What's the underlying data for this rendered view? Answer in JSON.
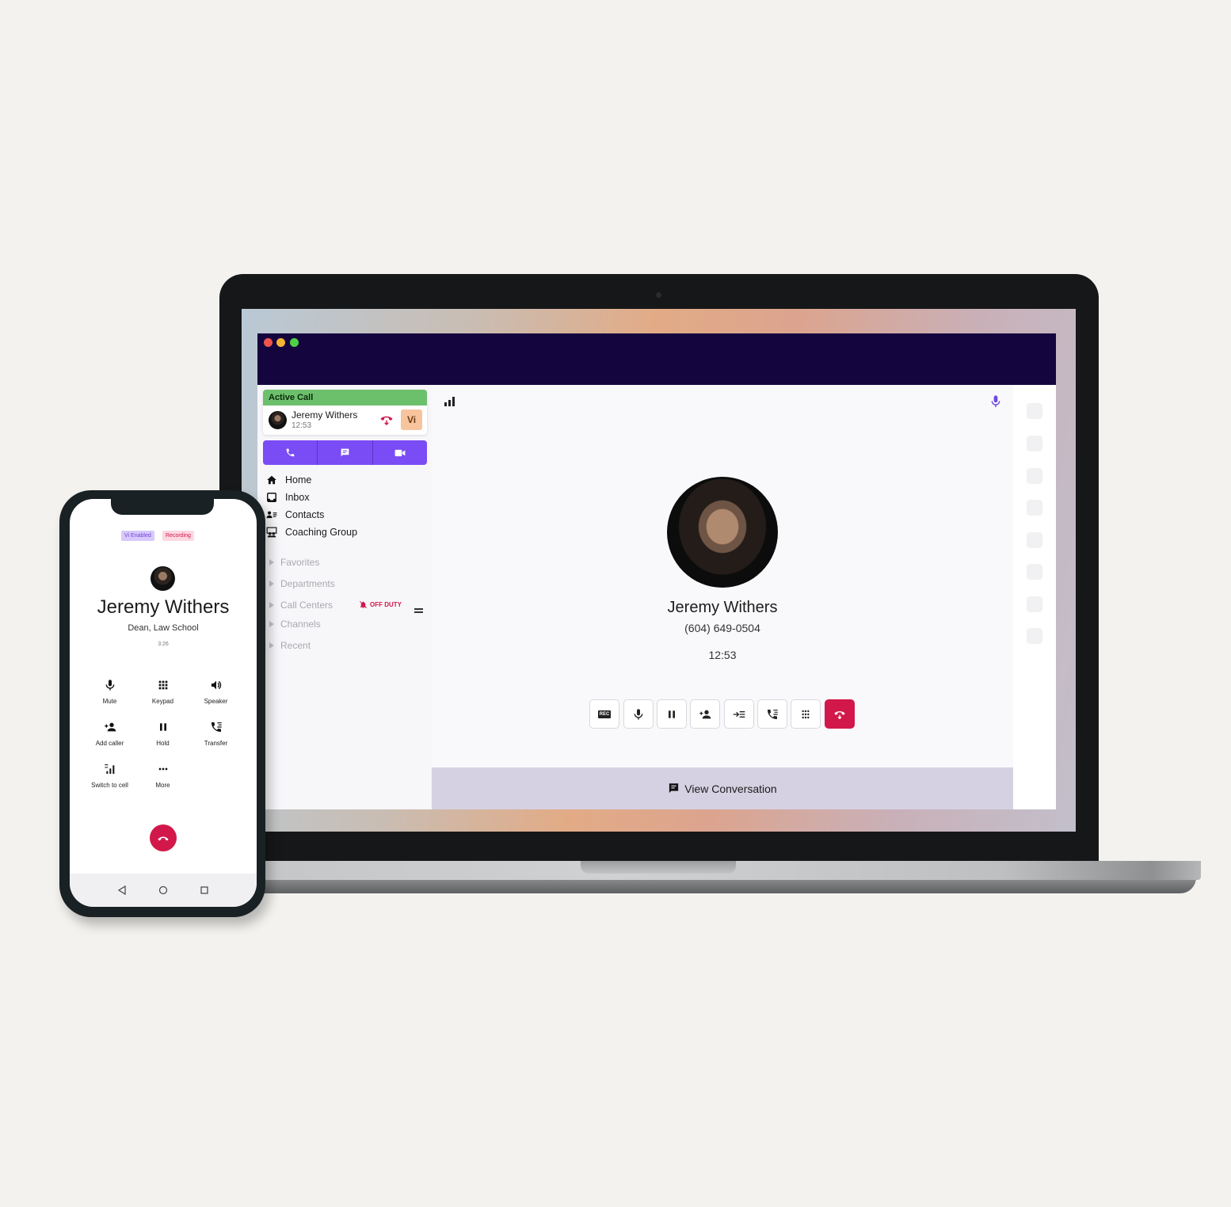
{
  "laptop_app": {
    "active_call": {
      "header": "Active Call",
      "caller_name": "Jeremy Withers",
      "duration": "12:53",
      "vi_badge": "Vi"
    },
    "comm_buttons": [
      "phone-icon",
      "message-icon",
      "video-icon"
    ],
    "nav": [
      {
        "label": "Home",
        "icon": "home-icon"
      },
      {
        "label": "Inbox",
        "icon": "inbox-icon"
      },
      {
        "label": "Contacts",
        "icon": "contacts-icon"
      },
      {
        "label": "Coaching Group",
        "icon": "coaching-group-icon"
      }
    ],
    "sections": [
      {
        "label": "Favorites"
      },
      {
        "label": "Departments"
      },
      {
        "label": "Call Centers",
        "status": "OFF DUTY"
      },
      {
        "label": "Channels"
      },
      {
        "label": "Recent"
      }
    ],
    "call": {
      "name": "Jeremy Withers",
      "phone": "(604) 649-0504",
      "timer": "12:53"
    },
    "controls": [
      "record",
      "mute",
      "hold",
      "add-caller",
      "merge",
      "transfer",
      "keypad",
      "hang-up"
    ],
    "rec_label": "REC",
    "view_conversation": "View Conversation",
    "colors": {
      "accent": "#7a4cf5",
      "titlebar": "#15053f",
      "active_green": "#6cc06c",
      "hangup": "#d2184a"
    }
  },
  "phone_app": {
    "badges": {
      "vi": "Vi Enabled",
      "recording": "Recording"
    },
    "name": "Jeremy Withers",
    "title": "Dean, Law School",
    "timer": "3:26",
    "buttons": [
      {
        "label": "Mute"
      },
      {
        "label": "Keypad"
      },
      {
        "label": "Speaker"
      },
      {
        "label": "Add caller"
      },
      {
        "label": "Hold"
      },
      {
        "label": "Transfer"
      },
      {
        "label": "Switch to cell"
      },
      {
        "label": "More"
      }
    ]
  }
}
